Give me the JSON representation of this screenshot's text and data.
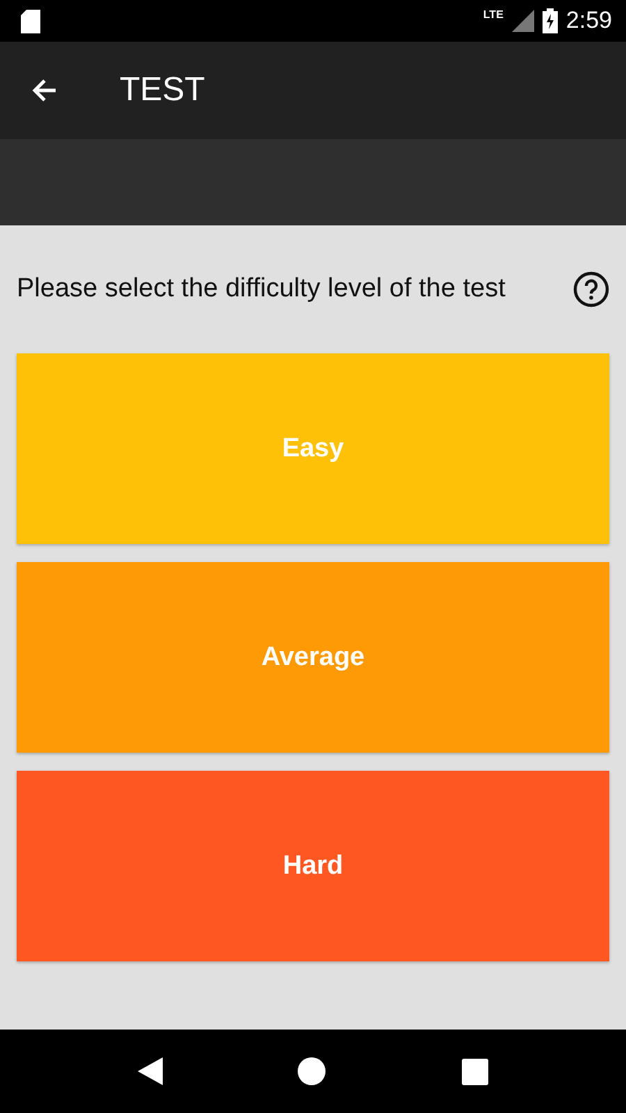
{
  "status_bar": {
    "time": "2:59",
    "network": "LTE"
  },
  "app_bar": {
    "title": "TEST"
  },
  "prompt": "Please select the difficulty level of the test",
  "options": [
    {
      "label": "Easy",
      "color": "#ffc107"
    },
    {
      "label": "Average",
      "color": "#ff9a07"
    },
    {
      "label": "Hard",
      "color": "#ff5722"
    }
  ]
}
